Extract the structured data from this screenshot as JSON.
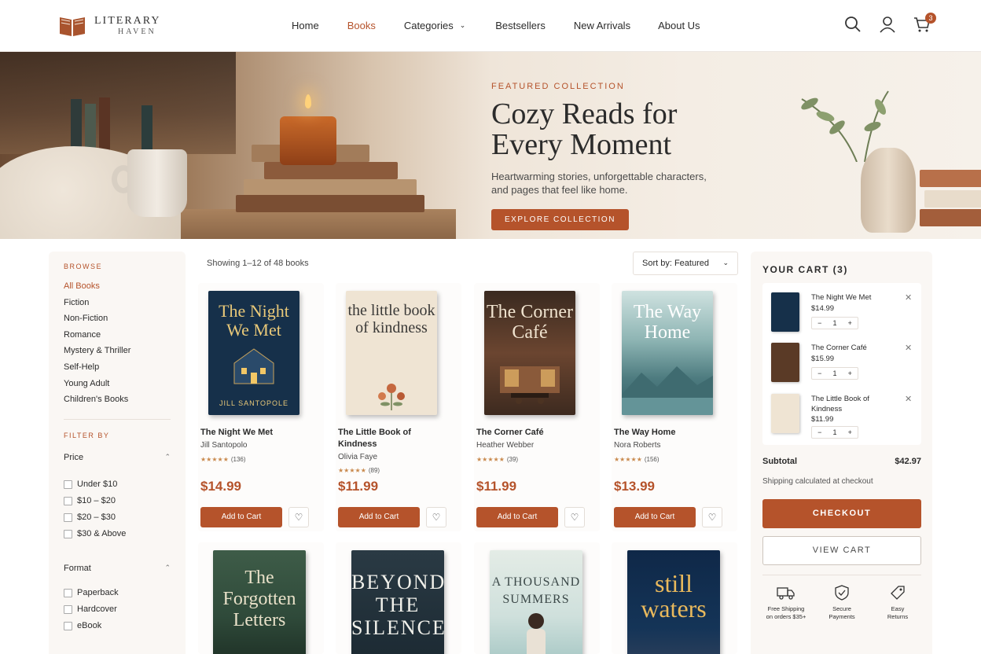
{
  "brand": {
    "line1": "LITERARY",
    "line2": "HAVEN"
  },
  "nav": [
    {
      "label": "Home",
      "active": false
    },
    {
      "label": "Books",
      "active": true
    },
    {
      "label": "Categories",
      "active": false,
      "dropdown": true
    },
    {
      "label": "Bestsellers",
      "active": false
    },
    {
      "label": "New Arrivals",
      "active": false
    },
    {
      "label": "About Us",
      "active": false
    }
  ],
  "header_icons": {
    "search": "search-icon",
    "account": "user-icon",
    "cart": "cart-icon",
    "cart_count": "3"
  },
  "hero": {
    "eyebrow": "FEATURED COLLECTION",
    "title_line1": "Cozy Reads for",
    "title_line2": "Every Moment",
    "subtitle": "Heartwarming stories, unforgettable characters, and pages that feel like home.",
    "button": "EXPLORE COLLECTION"
  },
  "sidebar": {
    "browse_label": "BROWSE",
    "categories": [
      "All Books",
      "Fiction",
      "Non-Fiction",
      "Romance",
      "Mystery & Thriller",
      "Self-Help",
      "Young Adult",
      "Children's Books"
    ],
    "filter_label": "FILTER BY",
    "price_label": "Price",
    "price_options": [
      "Under $10",
      "$10 – $20",
      "$20 – $30",
      "$30 & Above"
    ],
    "format_label": "Format",
    "format_options": [
      "Paperback",
      "Hardcover",
      "eBook"
    ]
  },
  "results_text": "Showing 1–12 of 48 books",
  "sort": {
    "label": "Sort by: Featured"
  },
  "products": [
    {
      "title": "The Night We Met",
      "author": "Jill Santopolo",
      "reviews": "(136)",
      "price": "$14.99",
      "rating": 4.5,
      "cover_title": "The Night We Met",
      "cover_author": "JILL SANTOPOLE",
      "add_label": "Add to Cart",
      "cover_bg": "#16304a"
    },
    {
      "title": "The Little Book of Kindness",
      "author": "Olivia Faye",
      "reviews": "(89)",
      "price": "$11.99",
      "rating": 4.5,
      "cover_title": "the little book of kindness",
      "cover_author": "",
      "add_label": "Add to Cart",
      "cover_bg": "#efe4d3"
    },
    {
      "title": "The Corner Café",
      "author": "Heather Webber",
      "reviews": "(39)",
      "price": "$11.99",
      "rating": 4.5,
      "cover_title": "The Corner Café",
      "cover_author": "",
      "add_label": "Add to Cart",
      "cover_bg": "#5a3a26"
    },
    {
      "title": "The Way Home",
      "author": "Nora Roberts",
      "reviews": "(156)",
      "price": "$13.99",
      "rating": 4.5,
      "cover_title": "The Way Home",
      "cover_author": "",
      "add_label": "Add to Cart",
      "cover_bg": "#7fa9a8"
    },
    {
      "title": "The Forgotten Letters",
      "cover_title": "The Forgotten Letters",
      "cover_bg": "#2f4a3a"
    },
    {
      "title": "Beyond the Silence",
      "cover_title": "BEYOND THE SILENCE",
      "cover_bg": "#1c2a33"
    },
    {
      "title": "A Thousand Summers",
      "cover_title": "A THOUSAND SUMMERS",
      "cover_bg": "#cfe0dc"
    },
    {
      "title": "Still Waters",
      "cover_title": "still waters",
      "cover_bg": "#143457"
    }
  ],
  "cart": {
    "title": "YOUR CART (3)",
    "items": [
      {
        "name": "The Night We Met",
        "price": "$14.99",
        "qty": "1",
        "thumb_bg": "#16304a"
      },
      {
        "name": "The Corner Café",
        "price": "$15.99",
        "qty": "1",
        "thumb_bg": "#5a3a26"
      },
      {
        "name": "The Little Book of Kindness",
        "price": "$11.99",
        "qty": "1",
        "thumb_bg": "#efe4d3"
      }
    ],
    "subtotal_label": "Subtotal",
    "subtotal": "$42.97",
    "shipping_note": "Shipping calculated at checkout",
    "checkout": "CHECKOUT",
    "view_cart": "VIEW CART",
    "perks": [
      {
        "icon": "truck-icon",
        "line1": "Free Shipping",
        "line2": "on orders $35+"
      },
      {
        "icon": "shield-icon",
        "line1": "Secure",
        "line2": "Payments"
      },
      {
        "icon": "tag-icon",
        "line1": "Easy",
        "line2": "Returns"
      }
    ]
  },
  "colors": {
    "accent": "#b5532b",
    "panel": "#faf7f4"
  }
}
